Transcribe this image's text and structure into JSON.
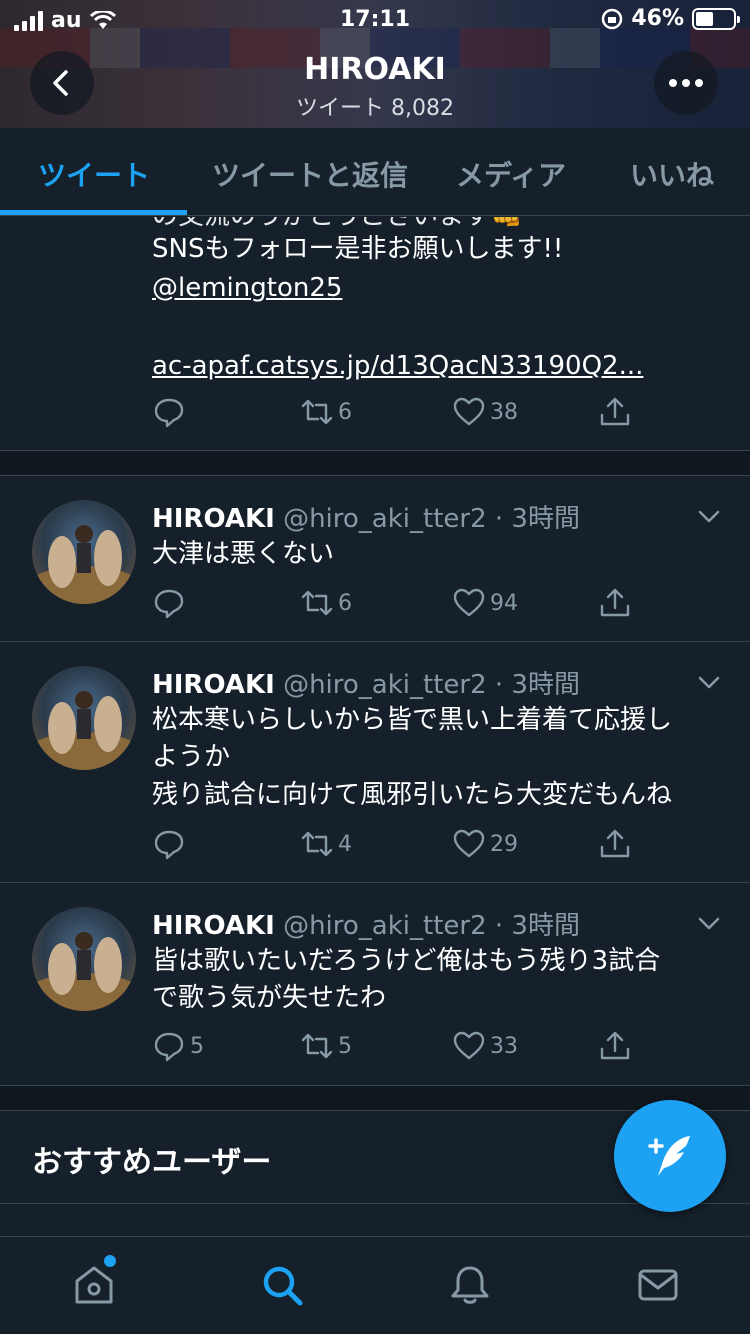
{
  "status_bar": {
    "carrier": "au",
    "time": "17:11",
    "battery": "46%"
  },
  "header": {
    "title": "HIROAKI",
    "tweet_count_label": "ツイート 8,082"
  },
  "tabs": [
    {
      "label": "ツイート",
      "active": true
    },
    {
      "label": "ツイートと返信",
      "active": false
    },
    {
      "label": "メディア",
      "active": false
    },
    {
      "label": "いいね",
      "active": false
    }
  ],
  "tweet0": {
    "line_partial": "の交流のうがとうございます👊",
    "line2": "SNSもフォロー是非お願いします!!",
    "mention": "@lemington25",
    "link": "ac-apaf.catsys.jp/d13QacN33190Q2...",
    "replies": "",
    "retweets": "6",
    "likes": "38"
  },
  "tweets": [
    {
      "name": "HIROAKI",
      "meta": "@hiro_aki_tter2 · 3時間",
      "lines": [
        "大津は悪くない"
      ],
      "replies": "",
      "retweets": "6",
      "likes": "94"
    },
    {
      "name": "HIROAKI",
      "meta": "@hiro_aki_tter2 · 3時間",
      "lines": [
        "松本寒いらしいから皆で黒い上着着て応援し",
        "ようか",
        "残り試合に向けて風邪引いたら大変だもんね"
      ],
      "replies": "",
      "retweets": "4",
      "likes": "29"
    },
    {
      "name": "HIROAKI",
      "meta": "@hiro_aki_tter2 · 3時間",
      "lines": [
        "皆は歌いたいだろうけど俺はもう残り3試合",
        "で歌う気が失せたわ"
      ],
      "replies": "5",
      "retweets": "5",
      "likes": "33"
    }
  ],
  "recommended": {
    "title": "おすすめユーザー"
  },
  "colors": {
    "background": "#15202b",
    "accent": "#1da1f2",
    "muted": "#8899a6",
    "divider": "#38444d"
  },
  "icons": {
    "back": "back-arrow-icon",
    "more": "more-dots-icon",
    "compose": "compose-feather-icon",
    "home": "home-icon",
    "search": "search-icon",
    "notifications": "bell-icon",
    "messages": "mail-icon"
  }
}
